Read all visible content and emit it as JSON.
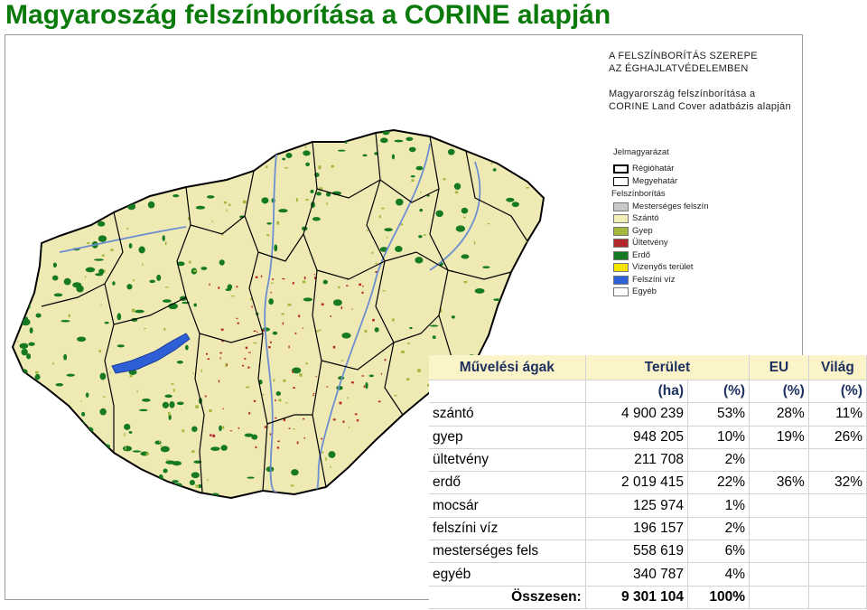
{
  "title": "Magyaroszág felszínborítása a CORINE alapján",
  "map": {
    "header_line1": "A FELSZÍNBORÍTÁS SZEREPE",
    "header_line2": "AZ ÉGHAJLATVÉDELEMBEN",
    "header_line3": "Magyarország felszínborítása a",
    "header_line4": "CORINE Land Cover adatbázis alapján",
    "legend_title": "Jelmagyarázat",
    "legend_items": [
      {
        "label": "Régióhatár",
        "style": "bold"
      },
      {
        "label": "Megyehatár",
        "style": "thin"
      }
    ],
    "legend_subtitle": "Felszínborítás",
    "cover_items": [
      {
        "label": "Mesterséges felszín",
        "color": "#c8c8c8"
      },
      {
        "label": "Szántó",
        "color": "#f2eeb8"
      },
      {
        "label": "Gyep",
        "color": "#a3b93e"
      },
      {
        "label": "Ültetvény",
        "color": "#b2282c"
      },
      {
        "label": "Erdő",
        "color": "#157a22"
      },
      {
        "label": "Vizenyős terület",
        "color": "#f5e400"
      },
      {
        "label": "Felszíni víz",
        "color": "#2e5fd6"
      },
      {
        "label": "Egyéb",
        "color": "#ffffff"
      }
    ]
  },
  "table": {
    "headers": [
      "Művelési ágak",
      "Terület",
      "EU",
      "Világ"
    ],
    "subheaders": [
      "(ha)",
      "(%)",
      "(%)",
      "(%)"
    ],
    "rows": [
      {
        "name": "szántó",
        "ha": "4 900 239",
        "pct": "53%",
        "eu": "28%",
        "world": "11%"
      },
      {
        "name": "gyep",
        "ha": "948 205",
        "pct": "10%",
        "eu": "19%",
        "world": "26%"
      },
      {
        "name": "ültetvény",
        "ha": "211 708",
        "pct": "2%",
        "eu": "",
        "world": ""
      },
      {
        "name": "erdő",
        "ha": "2 019 415",
        "pct": "22%",
        "eu": "36%",
        "world": "32%"
      },
      {
        "name": "mocsár",
        "ha": "125 974",
        "pct": "1%",
        "eu": "",
        "world": ""
      },
      {
        "name": "felszíni víz",
        "ha": "196 157",
        "pct": "2%",
        "eu": "",
        "world": ""
      },
      {
        "name": "mesterséges fels",
        "ha": "558 619",
        "pct": "6%",
        "eu": "",
        "world": ""
      },
      {
        "name": "egyéb",
        "ha": "340 787",
        "pct": "4%",
        "eu": "",
        "world": ""
      }
    ],
    "total": {
      "name": "Összesen:",
      "ha": "9 301 104",
      "pct": "100%"
    }
  },
  "colors": {
    "title": "#0a7a0a",
    "header_fill": "#fbf4c9",
    "header_text": "#1c2f5e",
    "map_base": "#efe9b4",
    "map_forest": "#157a22",
    "map_water": "#2e5fd6",
    "map_grass": "#a3b93e",
    "map_orchard": "#b2282c"
  }
}
